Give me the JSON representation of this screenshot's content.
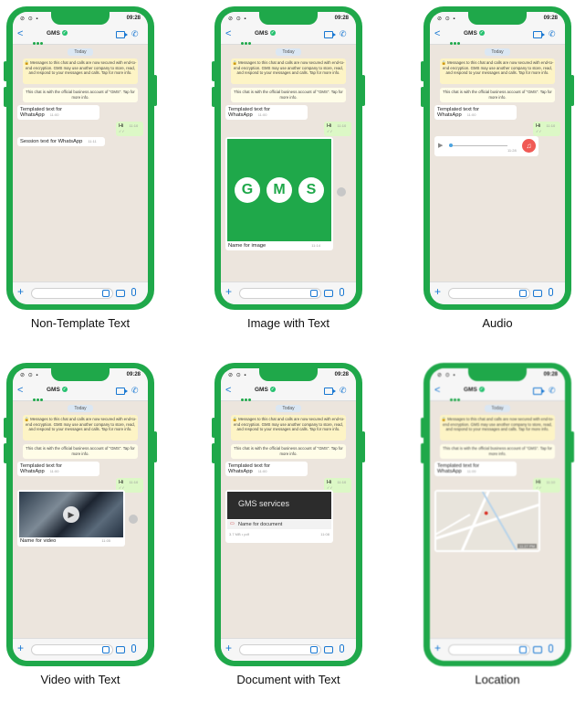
{
  "colors": {
    "frame": "#1fa84a",
    "accent": "#1877d2",
    "bubble_out": "#dcf8c6",
    "bubble_in": "#ffffff",
    "chat_bg": "#ece5dd",
    "notice_bg": "#fdf4c5"
  },
  "common": {
    "time": "09:28",
    "contact": "GMS",
    "date_chip": "Today",
    "encryption_note": "🔒 Messages to this chat and calls are now secured with end-to-end encryption. GMS may use another company to store, read, and respond to your messages and calls. Tap for more info.",
    "official_note": "This chat is with the official business account of \"GMS\". Tap for more info.",
    "templated_text": "Templated text for WhatsApp",
    "templated_time": "11:00",
    "reply_text": "Hi",
    "reply_time": "11:10 ✓✓"
  },
  "phones": [
    {
      "caption": "Non-Template Text",
      "session_text": "Session text for WhatsApp",
      "session_time": "11:11"
    },
    {
      "caption": "Image with Text",
      "image_logo": "GMS",
      "image_caption": "Name for image",
      "image_time": "11:14"
    },
    {
      "caption": "Audio",
      "audio_time": "11:28"
    },
    {
      "caption": "Video with Text",
      "video_caption": "Name for video",
      "video_time": "11:05"
    },
    {
      "caption": "Document with Text",
      "doc_title": "GMS services",
      "doc_name": "Name for document",
      "doc_meta": "3.7 MB • pdf",
      "doc_time": "11:08"
    },
    {
      "caption": "Location",
      "map_time": "11:27 PM"
    }
  ]
}
